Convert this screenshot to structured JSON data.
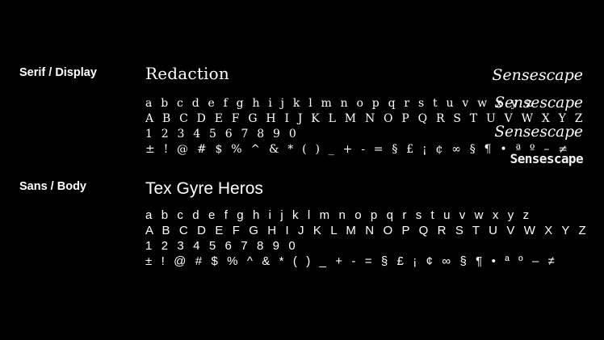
{
  "serif_section": {
    "label": "Serif / Display",
    "font_name": "Redaction",
    "glyph_lines": [
      "a b c d e f g h i j k l m n o p q r s t u v w x y z",
      "A B C D E F G H I J K L M N O P Q R S T U V W X Y Z",
      "1 2 3 4 5 6 7 8 9 0",
      "± ! @ # $ % ^ & * ( ) _ + - = § £ ¡ ¢ ∞ § ¶ • ª º – ≠"
    ]
  },
  "sans_section": {
    "label": "Sans / Body",
    "font_name": "Tex Gyre Heros",
    "glyph_lines": [
      "a b c d e f g h i j k l m n o p q r s t u v w x y z",
      "A B C D E F G H I J K L M N O P Q R S T U V W X Y Z",
      "1 2 3 4 5 6 7 8 9 0",
      "± ! @ # $ % ^ & * ( ) _ + - = § £ ¡ ¢ ∞ § ¶ • ª º – ≠"
    ]
  },
  "specimens": [
    "Sensescape",
    "Sensescape",
    "Sensescape",
    "Sensescape"
  ],
  "colors": {
    "background": "#000000",
    "text": "#ffffff"
  }
}
